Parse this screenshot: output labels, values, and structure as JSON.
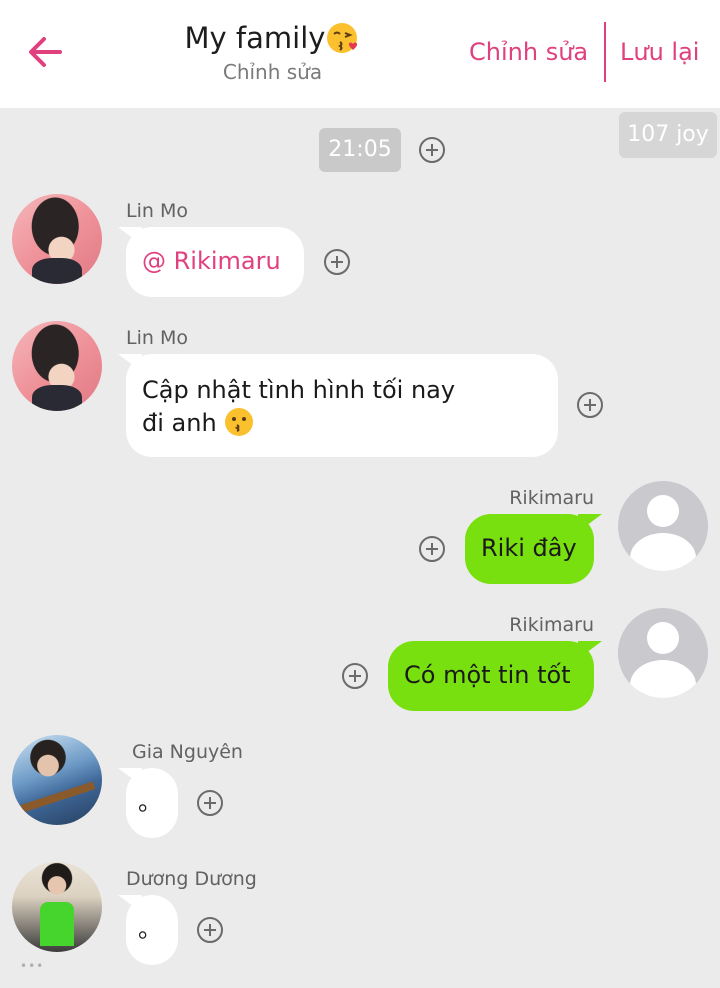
{
  "header": {
    "title": "My family",
    "subtitle": "Chỉnh sửa",
    "edit_label": "Chỉnh sửa",
    "save_label": "Lưu lại",
    "accent_color": "#e0407e"
  },
  "timestamp": "21:05",
  "watermark": "107 joy",
  "messages": [
    {
      "sender": "Lin Mo",
      "side": "left",
      "text": "@ Rikimaru",
      "avatar": "lin-mo-photo"
    },
    {
      "sender": "Lin Mo",
      "side": "left",
      "text_line1": "Cập nhật tình hình tối nay",
      "text_line2": "đi anh",
      "emoji": "kissing-face",
      "avatar": "lin-mo-photo"
    },
    {
      "sender": "Rikimaru",
      "side": "right",
      "text": "Riki đây",
      "avatar": "default-user-icon"
    },
    {
      "sender": "Rikimaru",
      "side": "right",
      "text": "Có một tin tốt",
      "avatar": "default-user-icon"
    },
    {
      "sender": "Gia Nguyên",
      "side": "left",
      "text": "。",
      "avatar": "gia-nguyen-photo"
    },
    {
      "sender": "Dương Dương",
      "side": "left",
      "text": "。",
      "avatar": "duong-duong-photo"
    }
  ],
  "colors": {
    "outgoing_bubble": "#79e00f",
    "incoming_bubble": "#ffffff",
    "background": "#ebebeb"
  }
}
